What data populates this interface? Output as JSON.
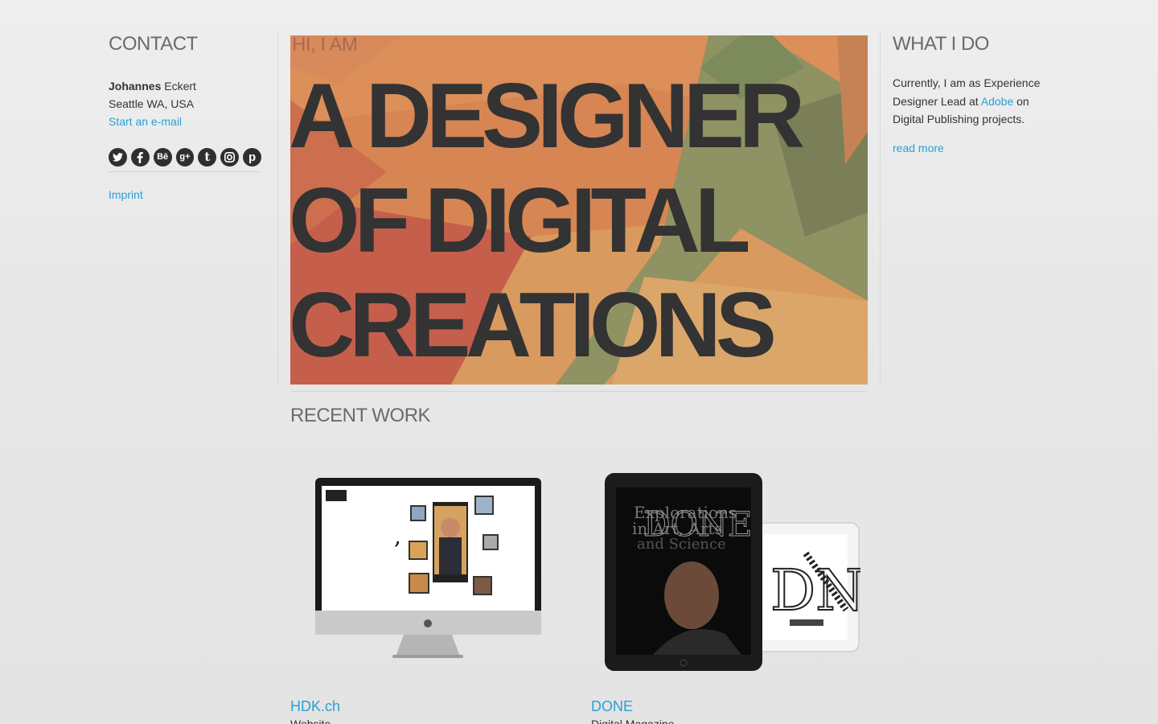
{
  "contact": {
    "heading": "CONTACT",
    "first_name": "Johannes",
    "last_name": " Eckert",
    "location": "Seattle WA, USA",
    "email_link": "Start an e-mail",
    "imprint_link": "Imprint",
    "social": [
      {
        "name": "twitter-icon",
        "glyph": "t"
      },
      {
        "name": "facebook-icon",
        "glyph": "f"
      },
      {
        "name": "behance-icon",
        "glyph": "Bē"
      },
      {
        "name": "google-plus-icon",
        "glyph": "g+"
      },
      {
        "name": "tumblr-icon",
        "glyph": "t"
      },
      {
        "name": "instagram-icon",
        "glyph": "◎"
      },
      {
        "name": "pinterest-icon",
        "glyph": "p"
      }
    ]
  },
  "hero": {
    "intro": "HI, I AM",
    "line1": "A DESIGNER",
    "line2": "OF DIGITAL",
    "line3": "CREATIONS"
  },
  "recent": {
    "heading": "RECENT WORK",
    "items": [
      {
        "title": "HDK.ch",
        "subtitle": "Website"
      },
      {
        "title": "DONE",
        "subtitle": "Digital Magazine"
      }
    ]
  },
  "what": {
    "heading": "WHAT I DO",
    "text_before": "Currently, I am as Experience Designer Lead at ",
    "link": "Adobe",
    "text_after": " on Digital Publishing projects.",
    "read_more": "read more"
  },
  "colors": {
    "link": "#2a9fd6",
    "heading": "#6b6b6b",
    "hero_text": "#333333"
  }
}
